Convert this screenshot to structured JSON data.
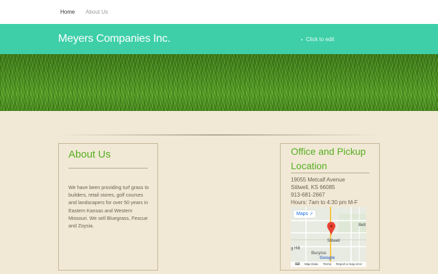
{
  "nav": {
    "home_label": "Home",
    "about_label": "About Us"
  },
  "header": {
    "site_title": "Meyers Companies Inc.",
    "edit_hint": "Click to edit"
  },
  "about": {
    "heading": "About Us",
    "body": "We have been providing turf grass to builders, retail stores, golf courses and landscapers for over 50 years in Eastern Kansas and Western Missouri. We sell Bluegrass, Fescue and Zoysia."
  },
  "office": {
    "heading": "Office and Pickup Location",
    "address_line1": "19055 Metcalf Avenue",
    "address_line2": "Stilwell, KS 66085",
    "phone": "913-681-2667",
    "hours": "Hours: 7am to 4:30 pm M-F"
  },
  "map": {
    "maps_button_label": "Maps",
    "labels": {
      "belt": "Belt",
      "stilwell": "Stilwell",
      "hill": "g Hill",
      "bucyrus": "Bucyrus",
      "google": "Google"
    },
    "footer": {
      "keyboard_icon": "keyboard-icon",
      "map_data": "Map Data",
      "terms": "Terms",
      "report": "Report a map error"
    },
    "colors": {
      "pin": "#ea4335",
      "road_main": "#f5c542",
      "road_minor": "#ffffff"
    }
  },
  "colors": {
    "header_bg": "#3ecfa9",
    "page_bg": "#f1e9d6",
    "heading_green": "#55ad1f"
  }
}
